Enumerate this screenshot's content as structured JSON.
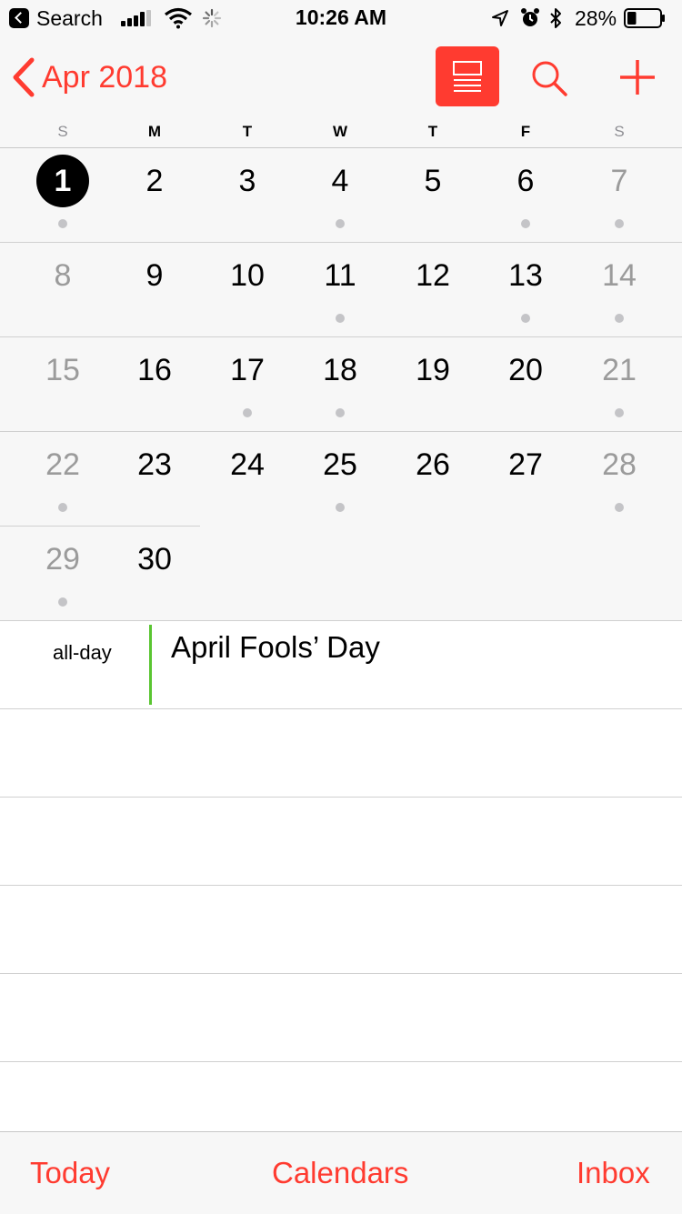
{
  "status_bar": {
    "back_app_label": "Search",
    "time": "10:26 AM",
    "battery_percent": "28%",
    "battery_level": 0.28,
    "icons": [
      "signal-icon",
      "wifi-icon",
      "activity-spinner-icon",
      "location-icon",
      "alarm-icon",
      "bluetooth-icon",
      "battery-icon"
    ]
  },
  "nav": {
    "back_label": "Apr 2018",
    "accent_color": "#ff3b30",
    "buttons": [
      "list-view-toggle-icon",
      "search-icon",
      "add-icon"
    ]
  },
  "weekdays": [
    "S",
    "M",
    "T",
    "W",
    "T",
    "F",
    "S"
  ],
  "month": {
    "weeks": [
      [
        {
          "d": "1",
          "today": true,
          "dot": true
        },
        {
          "d": "2"
        },
        {
          "d": "3"
        },
        {
          "d": "4",
          "dot": true
        },
        {
          "d": "5"
        },
        {
          "d": "6",
          "dot": true
        },
        {
          "d": "7",
          "dot": true
        }
      ],
      [
        {
          "d": "8"
        },
        {
          "d": "9"
        },
        {
          "d": "10"
        },
        {
          "d": "11",
          "dot": true
        },
        {
          "d": "12"
        },
        {
          "d": "13",
          "dot": true
        },
        {
          "d": "14",
          "dot": true
        }
      ],
      [
        {
          "d": "15"
        },
        {
          "d": "16"
        },
        {
          "d": "17",
          "dot": true
        },
        {
          "d": "18",
          "dot": true
        },
        {
          "d": "19"
        },
        {
          "d": "20"
        },
        {
          "d": "21",
          "dot": true
        }
      ],
      [
        {
          "d": "22",
          "dot": true
        },
        {
          "d": "23"
        },
        {
          "d": "24"
        },
        {
          "d": "25",
          "dot": true
        },
        {
          "d": "26"
        },
        {
          "d": "27"
        },
        {
          "d": "28",
          "dot": true
        }
      ],
      [
        {
          "d": "29",
          "dot": true
        },
        {
          "d": "30"
        }
      ]
    ]
  },
  "events": {
    "allday_label": "all-day",
    "items": [
      {
        "title": "April Fools’ Day",
        "color": "#5ac531"
      }
    ]
  },
  "tabs": {
    "today": "Today",
    "calendars": "Calendars",
    "inbox": "Inbox"
  }
}
